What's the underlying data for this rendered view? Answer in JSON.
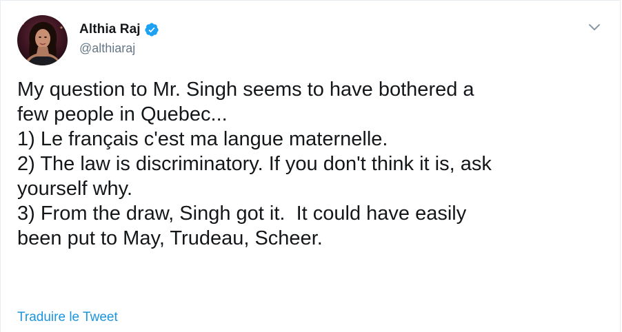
{
  "tweet": {
    "author": {
      "name": "Althia Raj",
      "handle": "@althiaraj",
      "verified_icon": "verified-badge-icon"
    },
    "menu_icon": "chevron-down-icon",
    "text_lines": [
      "My question to Mr. Singh seems to have bothered a",
      "few people in Quebec...",
      "1) Le français c'est ma langue maternelle.",
      "2) The law is discriminatory. If you don't think it is, ask",
      "yourself why.",
      "3) From the draw, Singh got it.  It could have easily",
      "been put to May, Trudeau, Scheer."
    ],
    "translate_label": "Traduire le Tweet"
  },
  "colors": {
    "text": "#14171a",
    "secondary": "#657786",
    "link": "#1b95e0",
    "verified": "#1da1f2",
    "border": "#e6ecf0"
  }
}
